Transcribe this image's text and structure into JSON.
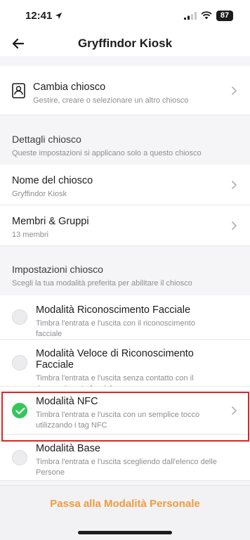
{
  "status": {
    "time": "12:41",
    "battery": "87"
  },
  "nav": {
    "title": "Gryffindor Kiosk"
  },
  "change_kiosk": {
    "title": "Cambia chiosco",
    "subtitle": "Gestire, creare o selezionare un altro chiosco"
  },
  "details": {
    "title": "Dettagli chiosco",
    "subtitle": "Queste impostazioni si applicano solo a questo chiosco",
    "items": [
      {
        "label": "Nome del chiosco",
        "value": "Gryffindor Kiosk"
      },
      {
        "label": "Membri & Gruppi",
        "value": "13 membri"
      }
    ]
  },
  "settings": {
    "title": "Impostazioni chiosco",
    "subtitle": "Scegli la tua modalità preferita per abilitare il chiosco",
    "modes": [
      {
        "title": "Modalità Riconoscimento Facciale",
        "desc": "Timbra l'entrata e l'uscita con il riconoscimento facciale",
        "selected": false
      },
      {
        "title": "Modalità Veloce di Riconoscimento Facciale",
        "desc": "Timbra l'entrata e l'uscita senza contatto con il riconoscimento facciale",
        "selected": false
      },
      {
        "title": "Modalità NFC",
        "desc": "Timbra l'entrata e l'uscita con un semplice tocco utilizzando i tag NFC",
        "selected": true
      },
      {
        "title": "Modalità Base",
        "desc": "Timbra l'entrata e l'uscita scegliendo dall'elenco delle Persone",
        "selected": false
      }
    ]
  },
  "footer": {
    "button": "Passa alla Modalità Personale"
  },
  "colors": {
    "accent": "#f29b3c",
    "selected": "#34c759",
    "highlight": "#e02424"
  }
}
